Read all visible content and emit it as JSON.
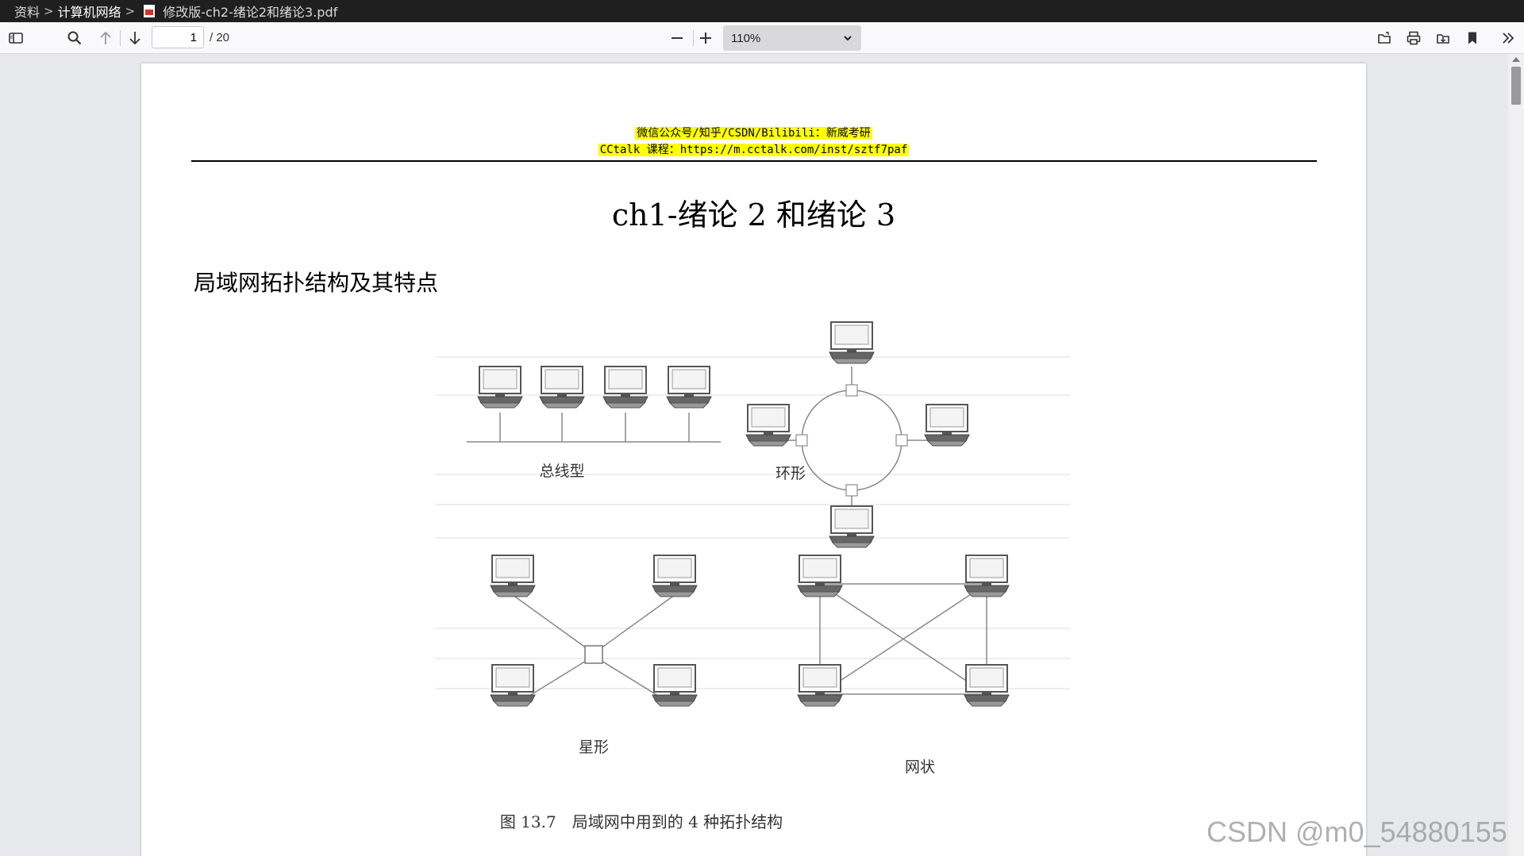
{
  "breadcrumb": {
    "items": [
      "资料",
      "计算机网络"
    ],
    "separator": ">",
    "filename": "修改版-ch2-绪论2和绪论3.pdf"
  },
  "toolbar": {
    "page_current": "1",
    "page_total": "/ 20",
    "zoom": "110%",
    "icons": [
      "sidebar-toggle-icon",
      "search-icon",
      "arrow-up-icon",
      "arrow-down-icon",
      "zoom-out-icon",
      "zoom-in-icon",
      "open-file-icon",
      "print-icon",
      "save-icon",
      "bookmark-icon",
      "more-tools-icon"
    ]
  },
  "document": {
    "watermark_line1": "微信公众号/知乎/CSDN/Bilibili：新威考研",
    "watermark_line2": "CCtalk 课程：https://m.cctalk.com/inst/sztf7paf",
    "title": "ch1-绪论 2 和绪论 3",
    "section_heading": "局域网拓扑结构及其特点",
    "figure": {
      "labels": {
        "bus": "总线型",
        "ring": "环形",
        "star": "星形",
        "mesh": "网状"
      },
      "caption": "图 13.7　局域网中用到的 4 种拓扑结构"
    }
  },
  "overlay": {
    "csdn_watermark": "CSDN @m0_54880155"
  },
  "colors": {
    "highlight": "#ffff00",
    "titlebar": "#1f1f1f",
    "toolbar": "#f9f9fb"
  }
}
